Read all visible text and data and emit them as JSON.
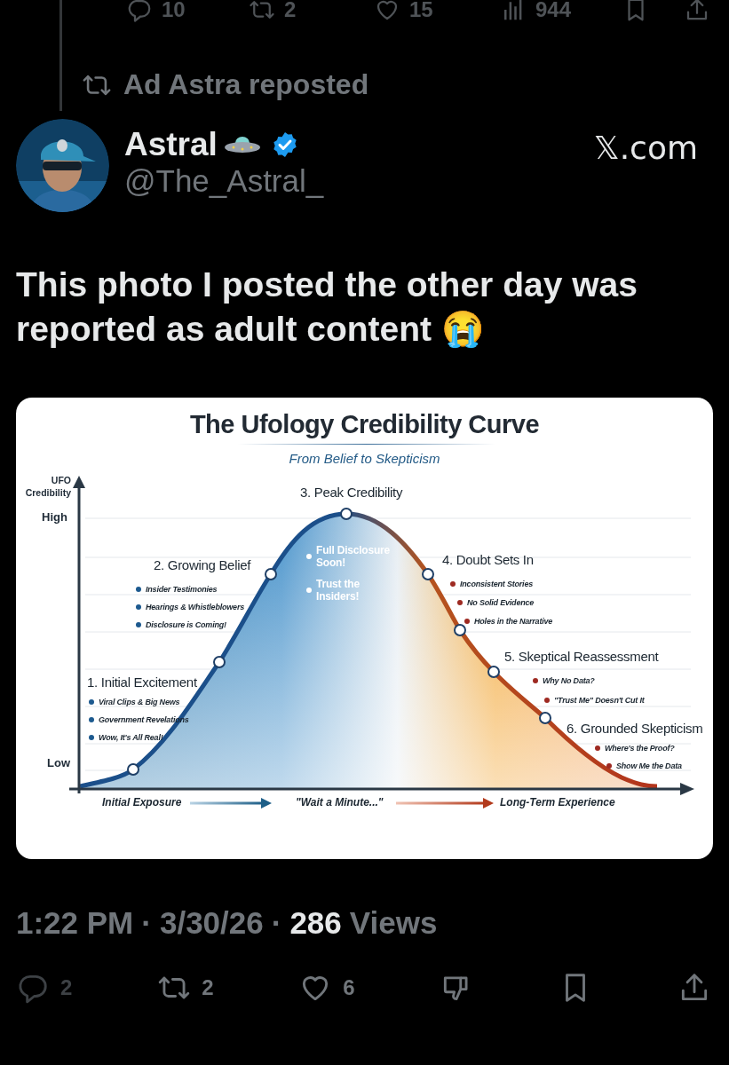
{
  "top_stats": [
    {
      "kind": "reply",
      "count": "10"
    },
    {
      "kind": "repost",
      "count": "2"
    },
    {
      "kind": "like",
      "count": "15"
    },
    {
      "kind": "views",
      "count": "944"
    },
    {
      "kind": "bookmark"
    },
    {
      "kind": "share"
    }
  ],
  "repost_banner": "Ad Astra reposted",
  "author": {
    "name": "Astral",
    "verified": true,
    "handle": "@The_Astral_"
  },
  "source": "𝕏.com",
  "post_text": "This photo I posted the other day was reported as adult content 😭",
  "infographic": {
    "title": "The Ufology Credibility Curve",
    "subtitle": "From Belief to Skepticism",
    "y_axis": {
      "title": "UFO Credibility",
      "high": "High",
      "low": "Low"
    },
    "x_axis": [
      "Initial Exposure",
      "\"Wait a Minute...\"",
      "Long-Term Experience"
    ],
    "stages": [
      {
        "title": "1. Initial Excitement",
        "color": "#1d5a8f",
        "points": [
          "Viral Clips & Big News",
          "Government Revelations",
          "Wow, It's All Real!"
        ]
      },
      {
        "title": "2. Growing Belief",
        "color": "#1d5a8f",
        "points": [
          "Insider Testimonies",
          "Hearings & Whistleblowers",
          "Disclosure is Coming!"
        ]
      },
      {
        "title": "3. Peak Credibility",
        "color": "#ffffff",
        "points": [
          "Full Disclosure Soon!",
          "Trust the Insiders!"
        ]
      },
      {
        "title": "4. Doubt Sets In",
        "color": "#9e2a22",
        "points": [
          "Inconsistent Stories",
          "No Solid Evidence",
          "Holes in the Narrative"
        ]
      },
      {
        "title": "5. Skeptical Reassessment",
        "color": "#9e2a22",
        "points": [
          "Why No Data?",
          "\"Trust Me\" Doesn't Cut It"
        ]
      },
      {
        "title": "6. Grounded Skepticism",
        "color": "#9e2a22",
        "points": [
          "Where's the Proof?",
          "Show Me the Data"
        ]
      }
    ]
  },
  "meta": [
    {
      "kind": "time",
      "text": "1:22 PM"
    },
    {
      "kind": "sep",
      "text": "·"
    },
    {
      "kind": "date",
      "text": "3/30/26"
    },
    {
      "kind": "sep",
      "text": "·"
    },
    {
      "kind": "count",
      "text": "286"
    },
    {
      "kind": "label",
      "text": "Views"
    }
  ],
  "actions": [
    {
      "kind": "reply",
      "count": "2"
    },
    {
      "kind": "repost",
      "count": "2"
    },
    {
      "kind": "like",
      "count": "6"
    },
    {
      "kind": "dislike"
    },
    {
      "kind": "bookmark"
    },
    {
      "kind": "share"
    }
  ]
}
